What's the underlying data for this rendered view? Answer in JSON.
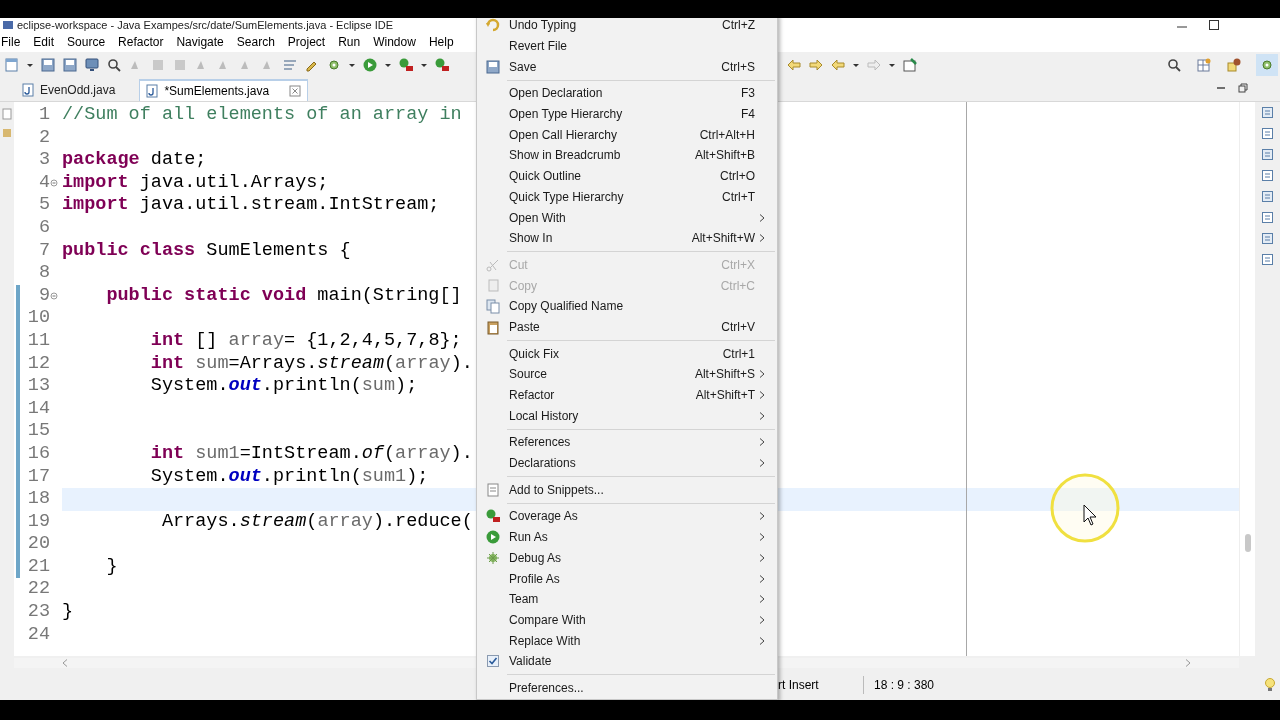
{
  "window": {
    "title": "eclipse-workspace - Java Exampes/src/date/SumElements.java - Eclipse IDE"
  },
  "menu_bar": [
    "File",
    "Edit",
    "Source",
    "Refactor",
    "Navigate",
    "Search",
    "Project",
    "Run",
    "Window",
    "Help"
  ],
  "tabs": [
    {
      "label": "EvenOdd.java",
      "selected": false
    },
    {
      "label": "*SumElements.java",
      "selected": true
    }
  ],
  "editor": {
    "lines": [
      {
        "number": "1",
        "changed": false,
        "current": false,
        "foldable": false,
        "segments": [
          {
            "text": "//Sum of all elements of an array in",
            "kind": "comment"
          }
        ]
      },
      {
        "number": "2",
        "changed": false,
        "current": false,
        "foldable": false
      },
      {
        "number": "3",
        "changed": false,
        "current": false,
        "foldable": false,
        "segments": [
          {
            "text": "package",
            "kind": "keyword"
          },
          {
            "text": " date;",
            "kind": "plain"
          }
        ]
      },
      {
        "number": "4",
        "changed": false,
        "current": false,
        "foldable": true,
        "segments": [
          {
            "text": "import",
            "kind": "keyword"
          },
          {
            "text": " java.util.Arrays;",
            "kind": "plain"
          }
        ]
      },
      {
        "number": "5",
        "changed": false,
        "current": false,
        "foldable": false,
        "segments": [
          {
            "text": "import",
            "kind": "keyword"
          },
          {
            "text": " java.util.stream.IntStream;",
            "kind": "plain"
          }
        ]
      },
      {
        "number": "6",
        "changed": false,
        "current": false,
        "foldable": false
      },
      {
        "number": "7",
        "changed": false,
        "current": false,
        "foldable": false,
        "segments": [
          {
            "text": "public class",
            "kind": "keyword"
          },
          {
            "text": " SumElements {",
            "kind": "plain"
          }
        ]
      },
      {
        "number": "8",
        "changed": false,
        "current": false,
        "foldable": false
      },
      {
        "number": "9",
        "changed": true,
        "current": false,
        "foldable": true,
        "segments": [
          {
            "text": "    public static void",
            "kind": "keyword"
          },
          {
            "text": " main(String[]",
            "kind": "plain"
          }
        ]
      },
      {
        "number": "10",
        "changed": true,
        "current": false,
        "foldable": false
      },
      {
        "number": "11",
        "changed": true,
        "current": false,
        "foldable": false,
        "segments": [
          {
            "text": "        int",
            "kind": "keyword"
          },
          {
            "text": " [] ",
            "kind": "plain"
          },
          {
            "text": "array",
            "kind": "variable"
          },
          {
            "text": "= {1,2,4,5,7,8};",
            "kind": "plain"
          }
        ]
      },
      {
        "number": "12",
        "changed": true,
        "current": false,
        "foldable": false,
        "segments": [
          {
            "text": "        int",
            "kind": "keyword"
          },
          {
            "text": " sum",
            "kind": "variable"
          },
          {
            "text": "=Arrays.",
            "kind": "plain"
          },
          {
            "text": "stream",
            "kind": "static_method"
          },
          {
            "text": "(",
            "kind": "plain"
          },
          {
            "text": "array",
            "kind": "variable"
          },
          {
            "text": ").",
            "kind": "plain"
          }
        ]
      },
      {
        "number": "13",
        "changed": true,
        "current": false,
        "foldable": false,
        "segments": [
          {
            "text": "        System.",
            "kind": "plain"
          },
          {
            "text": "out",
            "kind": "field"
          },
          {
            "text": ".println(",
            "kind": "plain"
          },
          {
            "text": "sum",
            "kind": "variable"
          },
          {
            "text": ");",
            "kind": "plain"
          }
        ]
      },
      {
        "number": "14",
        "changed": true,
        "current": false,
        "foldable": false
      },
      {
        "number": "15",
        "changed": true,
        "current": false,
        "foldable": false
      },
      {
        "number": "16",
        "changed": true,
        "current": false,
        "foldable": false,
        "segments": [
          {
            "text": "        int",
            "kind": "keyword"
          },
          {
            "text": " sum1",
            "kind": "variable"
          },
          {
            "text": "=IntStream.",
            "kind": "plain"
          },
          {
            "text": "of",
            "kind": "static_method"
          },
          {
            "text": "(",
            "kind": "plain"
          },
          {
            "text": "array",
            "kind": "variable"
          },
          {
            "text": ").",
            "kind": "plain"
          }
        ]
      },
      {
        "number": "17",
        "changed": true,
        "current": false,
        "foldable": false,
        "segments": [
          {
            "text": "        System.",
            "kind": "plain"
          },
          {
            "text": "out",
            "kind": "field"
          },
          {
            "text": ".println(",
            "kind": "plain"
          },
          {
            "text": "sum1",
            "kind": "variable"
          },
          {
            "text": ");",
            "kind": "plain"
          }
        ]
      },
      {
        "number": "18",
        "changed": true,
        "current": true,
        "foldable": false
      },
      {
        "number": "19",
        "changed": true,
        "current": false,
        "foldable": false,
        "segments": [
          {
            "text": "         Arrays.",
            "kind": "plain"
          },
          {
            "text": "stream",
            "kind": "static_method"
          },
          {
            "text": "(",
            "kind": "plain"
          },
          {
            "text": "array",
            "kind": "variable"
          },
          {
            "text": ").reduce(",
            "kind": "plain"
          }
        ]
      },
      {
        "number": "20",
        "changed": true,
        "current": false,
        "foldable": false
      },
      {
        "number": "21",
        "changed": true,
        "current": false,
        "foldable": false,
        "segments": [
          {
            "text": "    }",
            "kind": "plain"
          }
        ]
      },
      {
        "number": "22",
        "changed": false,
        "current": false,
        "foldable": false
      },
      {
        "number": "23",
        "changed": false,
        "current": false,
        "foldable": false,
        "segments": [
          {
            "text": "}",
            "kind": "plain"
          }
        ]
      },
      {
        "number": "24",
        "changed": false,
        "current": false,
        "foldable": false
      }
    ]
  },
  "context_menu": [
    {
      "kind": "item",
      "label": "Undo Typing",
      "shortcut": "Ctrl+Z",
      "submenu": false,
      "disabled": false
    },
    {
      "kind": "item",
      "label": "Revert File",
      "submenu": false,
      "disabled": false
    },
    {
      "kind": "item",
      "label": "Save",
      "shortcut": "Ctrl+S",
      "submenu": false,
      "disabled": false
    },
    {
      "kind": "separator"
    },
    {
      "kind": "item",
      "label": "Open Declaration",
      "shortcut": "F3",
      "submenu": false,
      "disabled": false
    },
    {
      "kind": "item",
      "label": "Open Type Hierarchy",
      "shortcut": "F4",
      "submenu": false,
      "disabled": false
    },
    {
      "kind": "item",
      "label": "Open Call Hierarchy",
      "shortcut": "Ctrl+Alt+H",
      "submenu": false,
      "disabled": false
    },
    {
      "kind": "item",
      "label": "Show in Breadcrumb",
      "shortcut": "Alt+Shift+B",
      "submenu": false,
      "disabled": false
    },
    {
      "kind": "item",
      "label": "Quick Outline",
      "shortcut": "Ctrl+O",
      "submenu": false,
      "disabled": false
    },
    {
      "kind": "item",
      "label": "Quick Type Hierarchy",
      "shortcut": "Ctrl+T",
      "submenu": false,
      "disabled": false
    },
    {
      "kind": "item",
      "label": "Open With",
      "submenu": true,
      "disabled": false
    },
    {
      "kind": "item",
      "label": "Show In",
      "shortcut": "Alt+Shift+W",
      "submenu": true,
      "disabled": false
    },
    {
      "kind": "separator"
    },
    {
      "kind": "item",
      "label": "Cut",
      "shortcut": "Ctrl+X",
      "submenu": false,
      "disabled": true
    },
    {
      "kind": "item",
      "label": "Copy",
      "shortcut": "Ctrl+C",
      "submenu": false,
      "disabled": true
    },
    {
      "kind": "item",
      "label": "Copy Qualified Name",
      "submenu": false,
      "disabled": false
    },
    {
      "kind": "item",
      "label": "Paste",
      "shortcut": "Ctrl+V",
      "submenu": false,
      "disabled": false
    },
    {
      "kind": "separator"
    },
    {
      "kind": "item",
      "label": "Quick Fix",
      "shortcut": "Ctrl+1",
      "submenu": false,
      "disabled": false
    },
    {
      "kind": "item",
      "label": "Source",
      "shortcut": "Alt+Shift+S",
      "submenu": true,
      "disabled": false
    },
    {
      "kind": "item",
      "label": "Refactor",
      "shortcut": "Alt+Shift+T",
      "submenu": true,
      "disabled": false
    },
    {
      "kind": "item",
      "label": "Local History",
      "submenu": true,
      "disabled": false
    },
    {
      "kind": "separator"
    },
    {
      "kind": "item",
      "label": "References",
      "submenu": true,
      "disabled": false
    },
    {
      "kind": "item",
      "label": "Declarations",
      "submenu": true,
      "disabled": false
    },
    {
      "kind": "separator"
    },
    {
      "kind": "item",
      "label": "Add to Snippets...",
      "submenu": false,
      "disabled": false
    },
    {
      "kind": "separator"
    },
    {
      "kind": "item",
      "label": "Coverage As",
      "submenu": true,
      "disabled": false
    },
    {
      "kind": "item",
      "label": "Run As",
      "submenu": true,
      "disabled": false
    },
    {
      "kind": "item",
      "label": "Debug As",
      "submenu": true,
      "disabled": false
    },
    {
      "kind": "item",
      "label": "Profile As",
      "submenu": true,
      "disabled": false
    },
    {
      "kind": "item",
      "label": "Team",
      "submenu": true,
      "disabled": false
    },
    {
      "kind": "item",
      "label": "Compare With",
      "submenu": true,
      "disabled": false
    },
    {
      "kind": "item",
      "label": "Replace With",
      "submenu": true,
      "disabled": false
    },
    {
      "kind": "check",
      "label": "Validate",
      "checked": true,
      "submenu": false,
      "disabled": false
    },
    {
      "kind": "separator"
    },
    {
      "kind": "item",
      "label": "Preferences...",
      "submenu": false,
      "disabled": false
    }
  ],
  "status_bar": {
    "insert_mode": "rt Insert",
    "position": "18 : 9 : 380"
  }
}
